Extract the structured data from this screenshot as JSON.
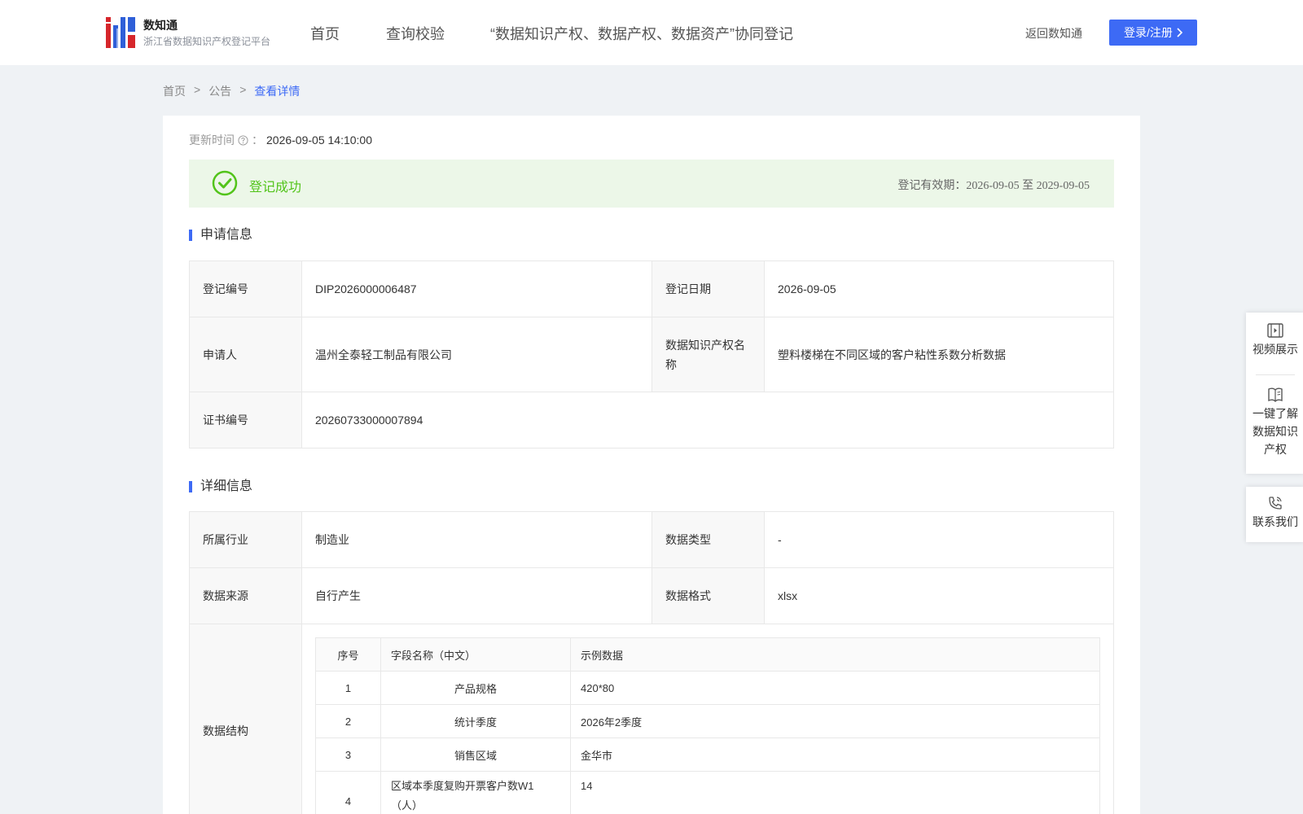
{
  "header": {
    "logo_title": "数知通",
    "logo_sub": "浙江省数据知识产权登记平台",
    "nav": [
      "首页",
      "查询校验",
      "“数据知识产权、数据产权、数据资产”协同登记"
    ],
    "back_label": "返回数知通",
    "login_label": "登录/注册"
  },
  "breadcrumb": {
    "home": "首页",
    "sep": ">",
    "notice": "公告",
    "current": "查看详情"
  },
  "update": {
    "label": "更新时间",
    "colon": "：",
    "value": "2026-09-05 14:10:00"
  },
  "status": {
    "text": "登记成功",
    "validity": "登记有效期：2026-09-05 至 2029-09-05"
  },
  "apply_section": {
    "title": "申请信息",
    "reg_no_label": "登记编号",
    "reg_no": "DIP2026000006487",
    "reg_date_label": "登记日期",
    "reg_date": "2026-09-05",
    "applicant_label": "申请人",
    "applicant": "温州全泰轻工制品有限公司",
    "ip_name_label": "数据知识产权名称",
    "ip_name": "塑料楼梯在不同区域的客户粘性系数分析数据",
    "cert_no_label": "证书编号",
    "cert_no": "20260733000007894"
  },
  "detail_section": {
    "title": "详细信息",
    "industry_label": "所属行业",
    "industry": "制造业",
    "type_label": "数据类型",
    "type": "-",
    "source_label": "数据来源",
    "source": "自行产生",
    "format_label": "数据格式",
    "format": "xlsx",
    "structure_label": "数据结构",
    "columns": [
      "序号",
      "字段名称（中文）",
      "示例数据"
    ],
    "rows": [
      {
        "idx": "1",
        "name": "产品规格",
        "sample": "420*80"
      },
      {
        "idx": "2",
        "name": "统计季度",
        "sample": "2026年2季度"
      },
      {
        "idx": "3",
        "name": "销售区域",
        "sample": "金华市"
      },
      {
        "idx": "4",
        "name": "区域本季度复购开票客户数W1（人）",
        "sample": "14"
      }
    ]
  },
  "float_panel": {
    "video": "视频展示",
    "learn": "一键了解数据知识产权",
    "contact": "联系我们"
  },
  "colors": {
    "accent": "#3d6af5",
    "success": "#52c41a",
    "success_bg": "#ecf7e8"
  }
}
